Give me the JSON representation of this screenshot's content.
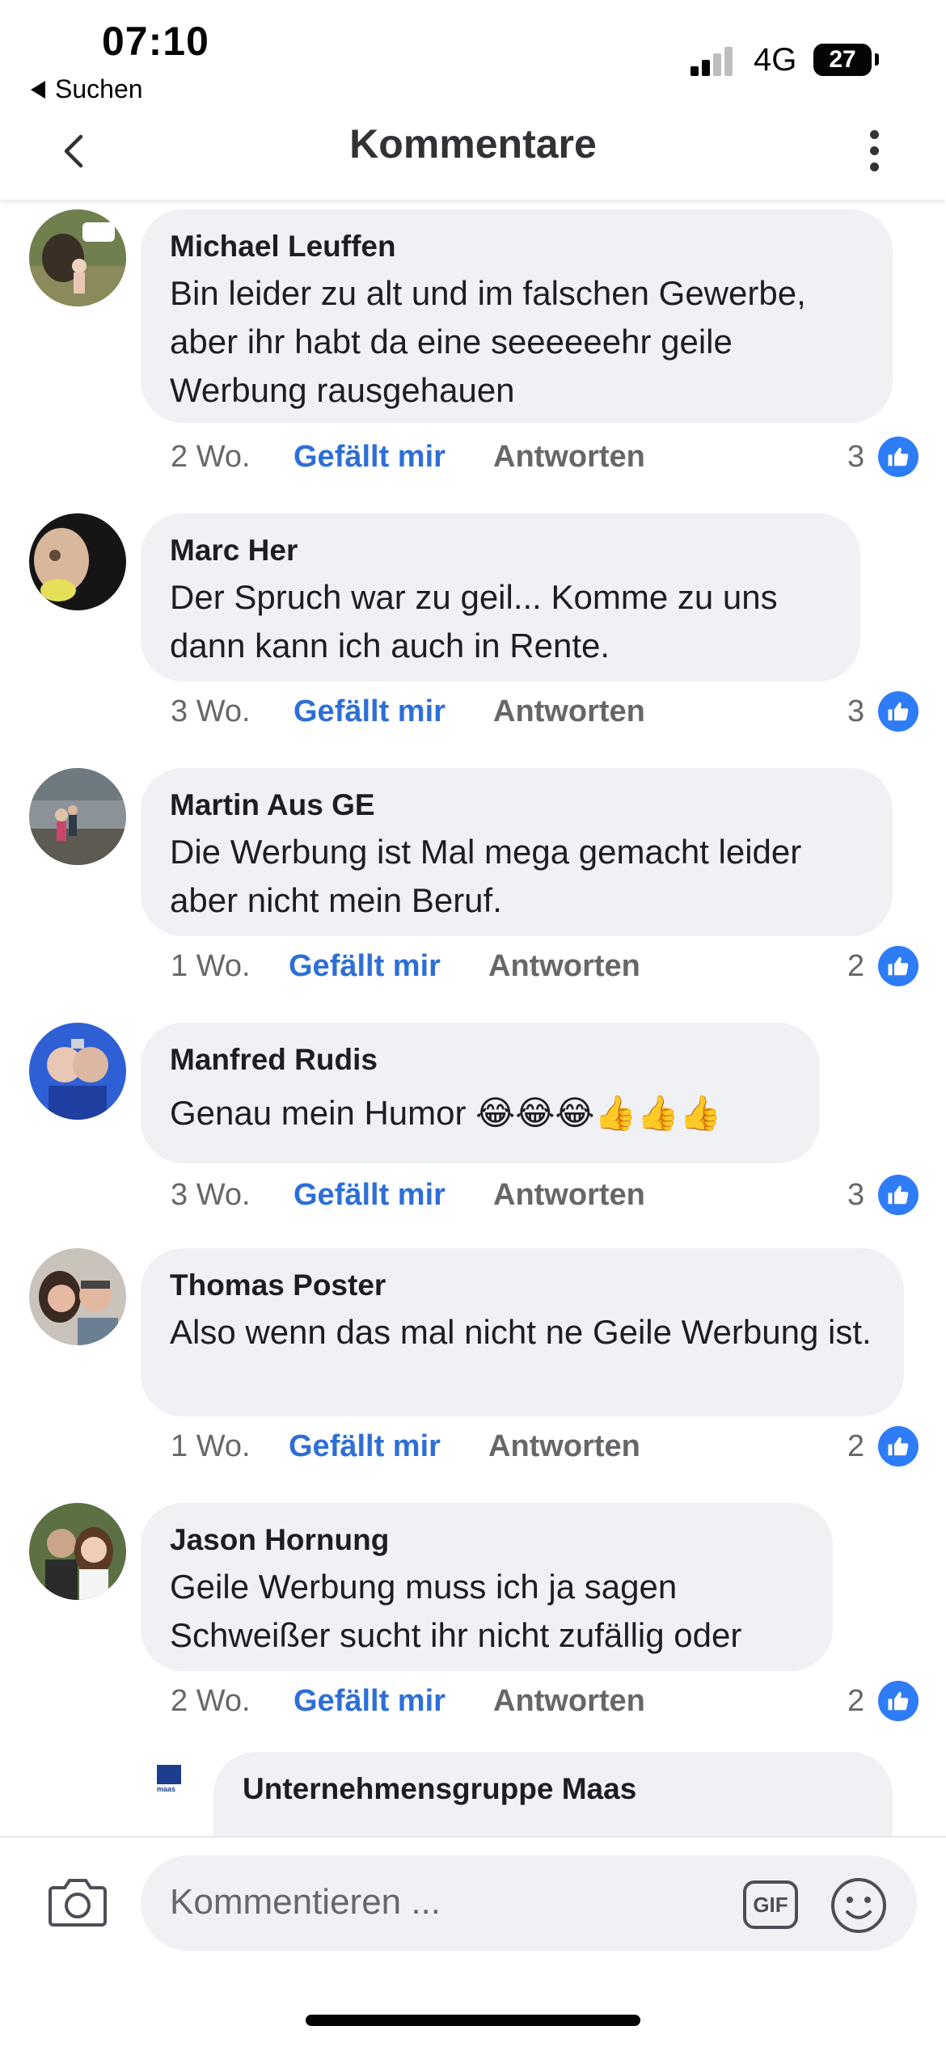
{
  "status_bar": {
    "time": "07:10",
    "back_app": "Suchen",
    "network": "4G",
    "battery": "27"
  },
  "header": {
    "title": "Kommentare",
    "back_icon": "chevron-left-icon",
    "more_icon": "vertical-dots-icon"
  },
  "actions": {
    "like_label": "Gefällt mir",
    "reply_label": "Antworten"
  },
  "comments": [
    {
      "author": "Michael Leuffen",
      "text": "Bin leider zu alt und im falschen Gewerbe, aber ihr habt da eine seeeeeehr geile Werbung rausgehauen",
      "age": "2 Wo.",
      "likes": "3"
    },
    {
      "author": "Marc Her",
      "text": "Der Spruch war zu geil... Komme zu uns dann kann ich auch in Rente.",
      "age": "3 Wo.",
      "likes": "3"
    },
    {
      "author": "Martin Aus GE",
      "text": "Die Werbung ist Mal mega gemacht leider aber nicht mein Beruf.",
      "age": "1 Wo.",
      "likes": "2"
    },
    {
      "author": "Manfred Rudis",
      "text": "Genau mein Humor 😂😂😂👍👍👍",
      "age": "3 Wo.",
      "likes": "3"
    },
    {
      "author": "Thomas Poster",
      "text": "Also wenn das mal nicht ne Geile Werbung ist.",
      "age": "1 Wo.",
      "likes": "2"
    },
    {
      "author": "Jason Hornung",
      "text": "Geile Werbung muss ich ja sagen Schweißer sucht ihr nicht zufällig oder",
      "age": "2 Wo.",
      "likes": "2"
    }
  ],
  "reply": {
    "author": "Unternehmensgruppe Maas",
    "logo_text": "maas"
  },
  "composer": {
    "placeholder": "Kommentieren ...",
    "gif_label": "GIF"
  },
  "colors": {
    "accent": "#2d6fd6",
    "bubble": "#eff1f4",
    "like_badge": "#2e7cf6"
  }
}
